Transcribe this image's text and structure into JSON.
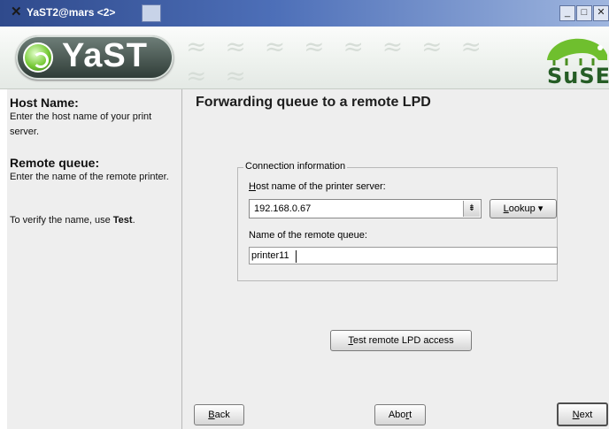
{
  "window": {
    "title": "YaST2@mars <2>",
    "buttons": [
      "minimize",
      "maximize",
      "close"
    ]
  },
  "banner": {
    "left_logo_text": "YaST",
    "right_logo_text": "SuSE"
  },
  "help": {
    "sections": [
      {
        "heading": "Host Name:",
        "text": "Enter the host name of your print server."
      },
      {
        "heading": "Remote queue:",
        "text": "Enter the name of the remote printer."
      }
    ],
    "verify_prefix": "To verify the name, use ",
    "verify_bold": "Test",
    "verify_suffix": "."
  },
  "main": {
    "heading": "Forwarding queue to a remote LPD",
    "group_title": "Connection information",
    "host_label": {
      "mnemonic": "H",
      "rest": "ost name of the printer server:"
    },
    "host_value": "192.168.0.67",
    "lookup_label": {
      "mnemonic": "L",
      "rest": "ookup"
    },
    "queue_label": "Name of the remote queue:",
    "queue_value": "printer11",
    "test_button": {
      "mnemonic": "T",
      "rest": "est remote LPD access"
    }
  },
  "footer": {
    "back": {
      "mnemonic": "B",
      "rest": "ack"
    },
    "abort": {
      "prefix": "Abo",
      "mnemonic": "r",
      "rest": "t"
    },
    "next": {
      "mnemonic": "N",
      "rest": "ext"
    }
  },
  "colors": {
    "titlebar": "#3a58a2",
    "panel": "#eeeeee",
    "text": "#1d1d1d"
  }
}
